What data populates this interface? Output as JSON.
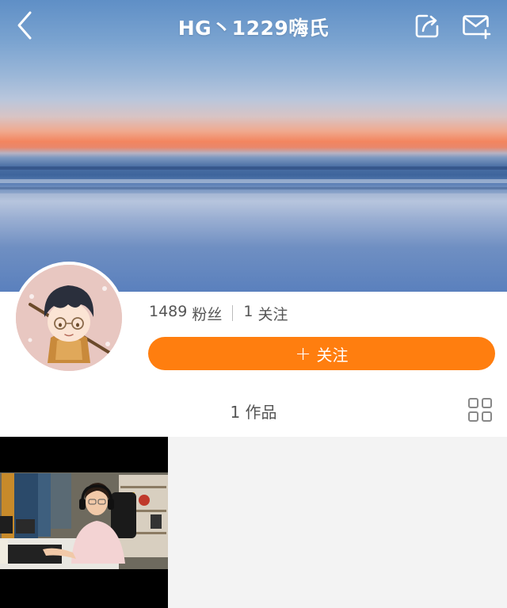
{
  "header": {
    "title": "HG丶1229嗨氏",
    "back_icon": "chevron-left-icon",
    "share_icon": "share-icon",
    "message_icon": "mail-icon"
  },
  "profile": {
    "fans_count": "1489",
    "fans_label": "粉丝",
    "following_count": "1",
    "following_label": "关注",
    "follow_button_label": "关注",
    "follow_button_color": "#ff7e0f"
  },
  "works": {
    "count_label": "1 作品",
    "grid_icon": "grid-view-icon"
  }
}
